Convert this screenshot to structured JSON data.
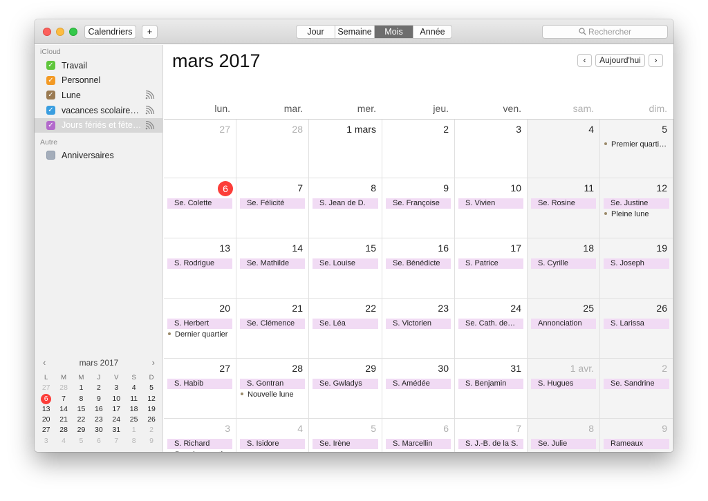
{
  "toolbar": {
    "calendars_label": "Calendriers",
    "add_label": "+",
    "views": [
      "Jour",
      "Semaine",
      "Mois",
      "Année"
    ],
    "active_view": "Mois",
    "search_placeholder": "Rechercher"
  },
  "sidebar": {
    "icloud_title": "iCloud",
    "other_title": "Autre",
    "calendars": [
      {
        "name": "Travail",
        "color": "#5fc63c",
        "checked": true,
        "shared": false
      },
      {
        "name": "Personnel",
        "color": "#f39a25",
        "checked": true,
        "shared": false
      },
      {
        "name": "Lune",
        "color": "#9a7a52",
        "checked": true,
        "shared": true
      },
      {
        "name": "vacances scolaire…",
        "color": "#3a9ee0",
        "checked": true,
        "shared": true
      },
      {
        "name": "Jours fériés et fête…",
        "color": "#b36acc",
        "checked": true,
        "shared": true,
        "selected": true
      }
    ],
    "other_calendars": [
      {
        "name": "Anniversaires",
        "color": "#8e9aab",
        "checked": false
      }
    ]
  },
  "mini_calendar": {
    "title": "mars 2017",
    "prev": "‹",
    "next": "›",
    "weekdays": [
      "L",
      "M",
      "M",
      "J",
      "V",
      "S",
      "D"
    ],
    "weeks": [
      [
        "27",
        "28",
        "1",
        "2",
        "3",
        "4",
        "5"
      ],
      [
        "6",
        "7",
        "8",
        "9",
        "10",
        "11",
        "12"
      ],
      [
        "13",
        "14",
        "15",
        "16",
        "17",
        "18",
        "19"
      ],
      [
        "20",
        "21",
        "22",
        "23",
        "24",
        "25",
        "26"
      ],
      [
        "27",
        "28",
        "29",
        "30",
        "31",
        "1",
        "2"
      ],
      [
        "3",
        "4",
        "5",
        "6",
        "7",
        "8",
        "9"
      ]
    ],
    "today": "6"
  },
  "header": {
    "month_title": "mars 2017",
    "prev": "‹",
    "today": "Aujourd'hui",
    "next": "›"
  },
  "weekdays": [
    "lun.",
    "mar.",
    "mer.",
    "jeu.",
    "ven.",
    "sam.",
    "dim."
  ],
  "weeks": [
    [
      {
        "day": "27",
        "dim": true
      },
      {
        "day": "28",
        "dim": true
      },
      {
        "day": "1 mars"
      },
      {
        "day": "2"
      },
      {
        "day": "3"
      },
      {
        "day": "4"
      },
      {
        "day": "5",
        "notes": [
          "Premier quarti…"
        ]
      }
    ],
    [
      {
        "day": "6",
        "today": true,
        "event": "Se. Colette"
      },
      {
        "day": "7",
        "event": "Se. Félicité"
      },
      {
        "day": "8",
        "event": "S. Jean de D."
      },
      {
        "day": "9",
        "event": "Se. Françoise"
      },
      {
        "day": "10",
        "event": "S. Vivien"
      },
      {
        "day": "11",
        "event": "Se. Rosine"
      },
      {
        "day": "12",
        "event": "Se. Justine",
        "notes": [
          "Pleine lune"
        ]
      }
    ],
    [
      {
        "day": "13",
        "event": "S. Rodrigue"
      },
      {
        "day": "14",
        "event": "Se. Mathilde"
      },
      {
        "day": "15",
        "event": "Se. Louise"
      },
      {
        "day": "16",
        "event": "Se. Bénédicte"
      },
      {
        "day": "17",
        "event": "S. Patrice"
      },
      {
        "day": "18",
        "event": "S. Cyrille"
      },
      {
        "day": "19",
        "event": "S. Joseph"
      }
    ],
    [
      {
        "day": "20",
        "event": "S. Herbert",
        "notes": [
          "Dernier quartier"
        ]
      },
      {
        "day": "21",
        "event": "Se. Clémence"
      },
      {
        "day": "22",
        "event": "Se. Léa"
      },
      {
        "day": "23",
        "event": "S. Victorien"
      },
      {
        "day": "24",
        "event": "Se. Cath. de…"
      },
      {
        "day": "25",
        "event": "Annonciation"
      },
      {
        "day": "26",
        "event": "S. Larissa"
      }
    ],
    [
      {
        "day": "27",
        "event": "S. Habib"
      },
      {
        "day": "28",
        "event": "S. Gontran",
        "notes": [
          "Nouvelle lune"
        ]
      },
      {
        "day": "29",
        "event": "Se. Gwladys"
      },
      {
        "day": "30",
        "event": "S. Amédée"
      },
      {
        "day": "31",
        "event": "S. Benjamin"
      },
      {
        "day": "1 avr.",
        "dim": true,
        "event": "S. Hugues"
      },
      {
        "day": "2",
        "dim": true,
        "event": "Se. Sandrine"
      }
    ],
    [
      {
        "day": "3",
        "dim": true,
        "event": "S. Richard",
        "notes": [
          "Premier quartier"
        ]
      },
      {
        "day": "4",
        "dim": true,
        "event": "S. Isidore"
      },
      {
        "day": "5",
        "dim": true,
        "event": "Se. Irène"
      },
      {
        "day": "6",
        "dim": true,
        "event": "S. Marcellin"
      },
      {
        "day": "7",
        "dim": true,
        "event": "S. J.-B. de la S."
      },
      {
        "day": "8",
        "dim": true,
        "event": "Se. Julie"
      },
      {
        "day": "9",
        "dim": true,
        "event": "Rameaux"
      }
    ]
  ]
}
